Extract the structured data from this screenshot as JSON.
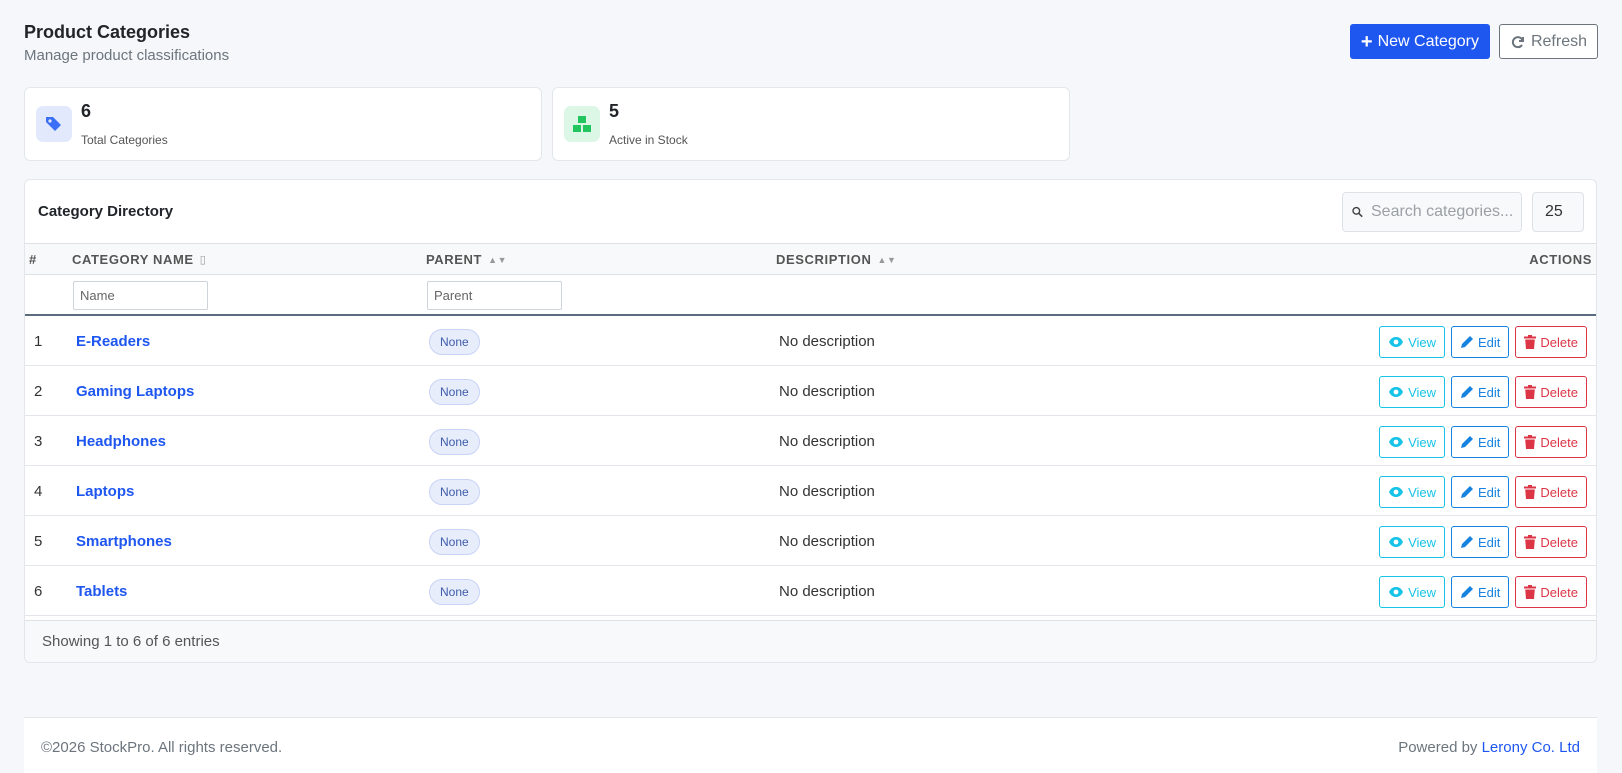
{
  "header": {
    "title": "Product Categories",
    "subtitle": "Manage product classifications",
    "new_label": "New Category",
    "refresh_label": "Refresh"
  },
  "stats": [
    {
      "value": "6",
      "label": "Total Categories",
      "icon": "tags-icon",
      "color": "#3b6ff5",
      "bg": "#e3e9fd"
    },
    {
      "value": "5",
      "label": "Active in Stock",
      "icon": "boxes-icon",
      "color": "#22c55e",
      "bg": "#dcf7e6"
    }
  ],
  "directory": {
    "title": "Category Directory",
    "search_placeholder": "Search categories...",
    "page_size": "25",
    "columns": [
      "#",
      "CATEGORY NAME",
      "PARENT",
      "DESCRIPTION",
      "ACTIONS"
    ],
    "filters": {
      "name_placeholder": "Name",
      "parent_placeholder": "Parent"
    },
    "rows": [
      {
        "num": "1",
        "name": "E-Readers",
        "parent": "None",
        "description": "No description"
      },
      {
        "num": "2",
        "name": "Gaming Laptops",
        "parent": "None",
        "description": "No description"
      },
      {
        "num": "3",
        "name": "Headphones",
        "parent": "None",
        "description": "No description"
      },
      {
        "num": "4",
        "name": "Laptops",
        "parent": "None",
        "description": "No description"
      },
      {
        "num": "5",
        "name": "Smartphones",
        "parent": "None",
        "description": "No description"
      },
      {
        "num": "6",
        "name": "Tablets",
        "parent": "None",
        "description": "No description"
      }
    ],
    "actions": {
      "view": "View",
      "edit": "Edit",
      "delete": "Delete"
    },
    "footer_text": "Showing 1 to 6 of 6 entries"
  },
  "footer": {
    "copyright": "©2026 StockPro. All rights reserved.",
    "powered_prefix": "Powered by ",
    "powered_link": "Lerony Co. Ltd"
  }
}
